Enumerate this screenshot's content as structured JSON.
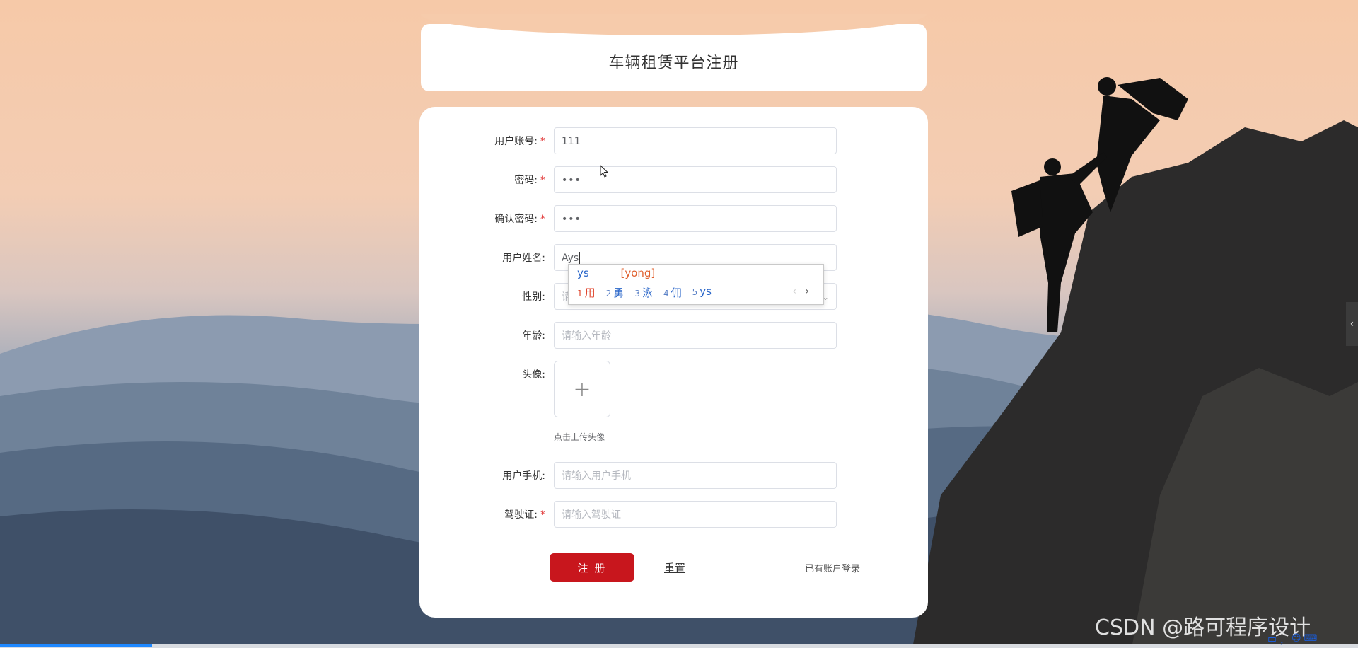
{
  "page": {
    "title": "车辆租赁平台注册"
  },
  "form": {
    "fields": [
      {
        "label": "用户账号:",
        "required": true,
        "value": "111",
        "placeholder": ""
      },
      {
        "label": "密码:",
        "required": true,
        "value": "•••",
        "placeholder": ""
      },
      {
        "label": "确认密码:",
        "required": true,
        "value": "•••",
        "placeholder": ""
      },
      {
        "label": "用户姓名:",
        "required": false,
        "value": "Ays",
        "placeholder": ""
      },
      {
        "label": "性别:",
        "required": false,
        "value": "",
        "placeholder": "请"
      },
      {
        "label": "年龄:",
        "required": false,
        "value": "",
        "placeholder": "请输入年龄"
      },
      {
        "label": "头像:",
        "required": false
      },
      {
        "label": "用户手机:",
        "required": false,
        "value": "",
        "placeholder": "请输入用户手机"
      },
      {
        "label": "驾驶证:",
        "required": true,
        "value": "",
        "placeholder": "请输入驾驶证"
      }
    ],
    "upload_hint": "点击上传头像",
    "upload_plus": "+",
    "required_mark": "*",
    "buttons": {
      "register": "注 册",
      "reset": "重置",
      "login_link": "已有账户登录"
    }
  },
  "ime": {
    "input": "ys",
    "pinyin": "[yong]",
    "candidates": [
      {
        "num": "1",
        "text": "用"
      },
      {
        "num": "2",
        "text": "勇"
      },
      {
        "num": "3",
        "text": "泳"
      },
      {
        "num": "4",
        "text": "佣"
      },
      {
        "num": "5",
        "text": "ys"
      }
    ],
    "prev": "‹",
    "next": "›"
  },
  "side_handle": "‹",
  "watermark": "CSDN @路可程序设计",
  "tray": [
    "中",
    "，",
    "☺",
    "⌨"
  ],
  "colors": {
    "accent": "#c8161d",
    "required": "#e23b3b"
  }
}
